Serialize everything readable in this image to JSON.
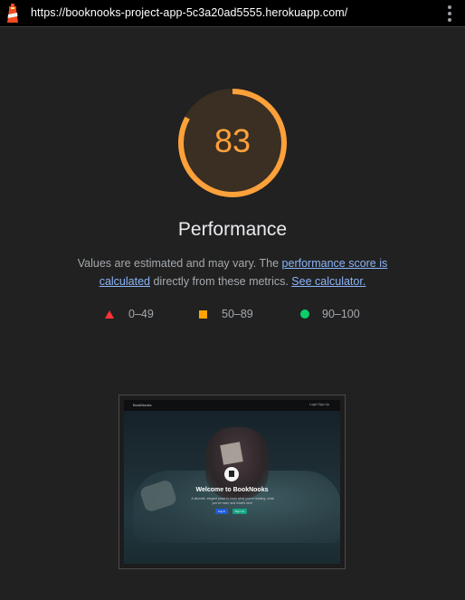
{
  "browser": {
    "url": "https://booknooks-project-app-5c3a20ad5555.herokuapp.com/"
  },
  "score": {
    "value": 83,
    "fraction": 0.83,
    "color": "#ffa13a",
    "track_color": "#3a2f22"
  },
  "title": "Performance",
  "description": {
    "text_before": "Values are estimated and may vary. The ",
    "link_score": "performance score is calculated",
    "text_middle": " directly from these metrics. ",
    "link_calculator": "See calculator."
  },
  "legend": [
    {
      "icon": "red-triangle-icon",
      "label": "0–49",
      "color": "#ff3333"
    },
    {
      "icon": "orange-square-icon",
      "label": "50–89",
      "color": "#ffa400"
    },
    {
      "icon": "green-circle-icon",
      "label": "90–100",
      "color": "#0cce6b"
    }
  ],
  "screenshot": {
    "brand": "BookNooks",
    "nav_links": "Login   Sign Up",
    "heading": "Welcome to BookNooks",
    "subtext": "A discrete, elegant place to track what you're reading, what you've read, and what's next.",
    "login_label": "Log in",
    "signup_label": "Sign Up"
  }
}
